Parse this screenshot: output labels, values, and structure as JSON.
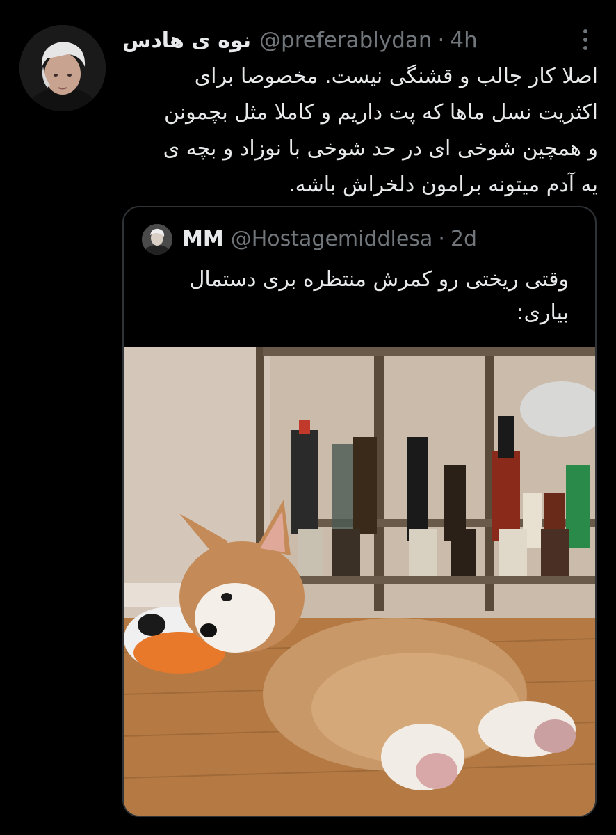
{
  "tweet": {
    "display_name": "نوه ی هادس",
    "handle": "@preferablydan",
    "separator": "·",
    "time": "4h",
    "more_icon": "more-vertical-icon",
    "body_lines": [
      "اصلا کار جالب و قشنگی نیست. مخصوصا برای",
      "اکثریت نسل ماها که پت داریم و کاملا مثل بچمونن",
      "و همچین شوخی ای در حد شوخی با نوزاد و بچه ی",
      "یه آدم میتونه برامون دلخراش باشه."
    ]
  },
  "quote": {
    "display_name": "MM",
    "handle": "@Hostagemiddlesa",
    "separator": "·",
    "time": "2d",
    "body_lines": [
      "وقتی ریختی رو کمرش منتظره بری دستمال",
      "بیاری:"
    ],
    "image": "corgi-puppy-photo"
  },
  "colors": {
    "background": "#000000",
    "primary_text": "#e7e9ea",
    "secondary_text": "#71767b",
    "border": "#2f3336"
  }
}
